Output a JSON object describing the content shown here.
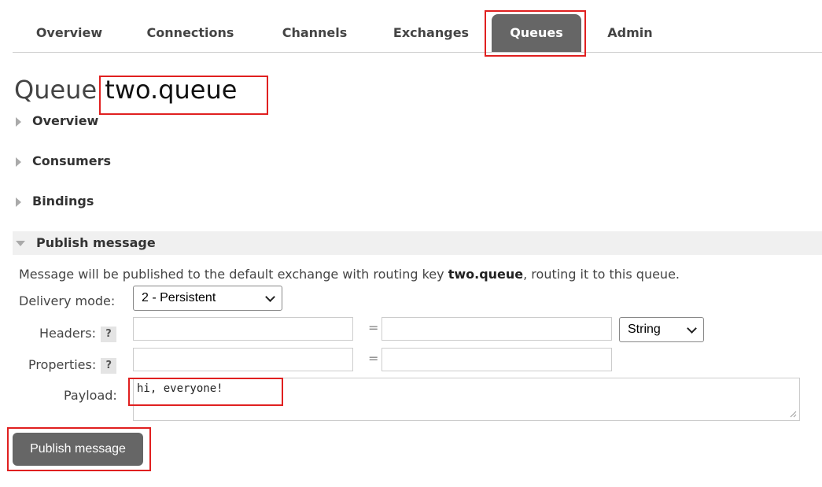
{
  "nav": {
    "items": [
      {
        "label": "Overview"
      },
      {
        "label": "Connections"
      },
      {
        "label": "Channels"
      },
      {
        "label": "Exchanges"
      },
      {
        "label": "Queues",
        "active": true
      },
      {
        "label": "Admin"
      }
    ]
  },
  "page": {
    "title_prefix": "Queue",
    "queue_name": "two.queue"
  },
  "sections": {
    "overview": "Overview",
    "consumers": "Consumers",
    "bindings": "Bindings",
    "publish": "Publish message"
  },
  "publish": {
    "description_pre": "Message will be published to the default exchange with routing key ",
    "routing_key": "two.queue",
    "description_post": ", routing it to this queue.",
    "delivery_mode_label": "Delivery mode:",
    "delivery_mode_value": "2 - Persistent",
    "headers_label": "Headers:",
    "headers_help": "?",
    "headers_type": "String",
    "equals": "=",
    "properties_label": "Properties:",
    "properties_help": "?",
    "payload_label": "Payload:",
    "payload_value": "hi, everyone!",
    "button_label": "Publish message"
  },
  "colors": {
    "highlight": "#e02020",
    "active_tab": "#666666"
  }
}
